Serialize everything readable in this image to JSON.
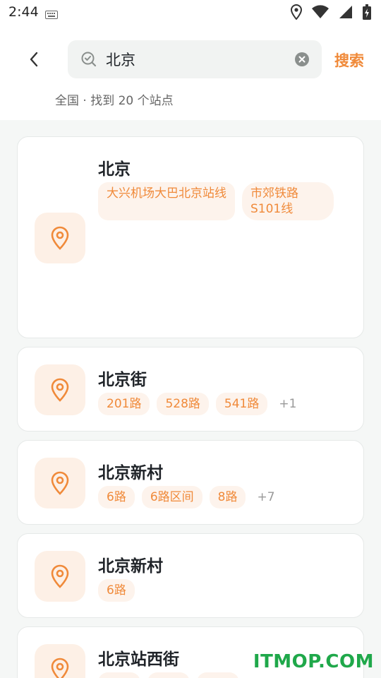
{
  "status_bar": {
    "time": "2:44"
  },
  "header": {
    "search_value": "北京",
    "search_button": "搜索",
    "result_summary": "全国 · 找到 20 个站点"
  },
  "stops": [
    {
      "name": "北京",
      "lines": [
        "大兴机场大巴北京站线",
        "市郊铁路S101线"
      ],
      "more": ""
    },
    {
      "name": "北京街",
      "lines": [
        "201路",
        "528路",
        "541路"
      ],
      "more": "+1"
    },
    {
      "name": "北京新村",
      "lines": [
        "6路",
        "6路区间",
        "8路"
      ],
      "more": "+7"
    },
    {
      "name": "北京新村",
      "lines": [
        "6路"
      ],
      "more": ""
    },
    {
      "name": "北京站西街",
      "lines": [
        "",
        "",
        ""
      ],
      "more": ""
    }
  ],
  "watermark": "ITMOP.COM",
  "colors": {
    "accent": "#f08a3a",
    "tag_bg": "#fdf3ec",
    "pin_bg": "#fdf0e6"
  }
}
